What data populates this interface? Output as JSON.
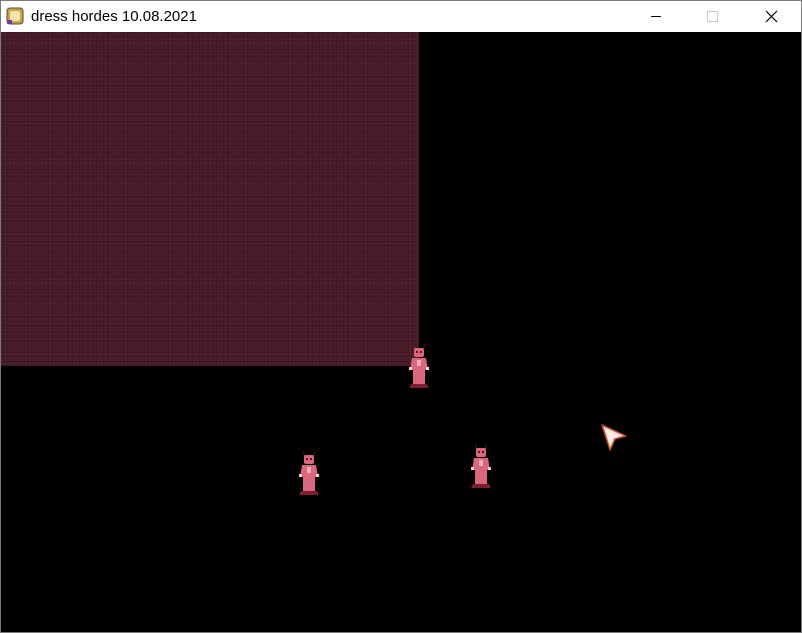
{
  "window": {
    "title": "dress hordes 10.08.2021",
    "controls": [
      "minimize-icon",
      "maximize-icon",
      "close-icon"
    ]
  },
  "game": {
    "background_color": "#000000",
    "floor_color": "#441724",
    "unit_color": "#d9687c",
    "units": [
      {
        "id": "unit-1",
        "kind": "horned-figure"
      },
      {
        "id": "unit-2",
        "kind": "horned-figure"
      },
      {
        "id": "unit-3",
        "kind": "horned-figure"
      }
    ],
    "cursor_icon": "arrow-cursor-icon"
  }
}
